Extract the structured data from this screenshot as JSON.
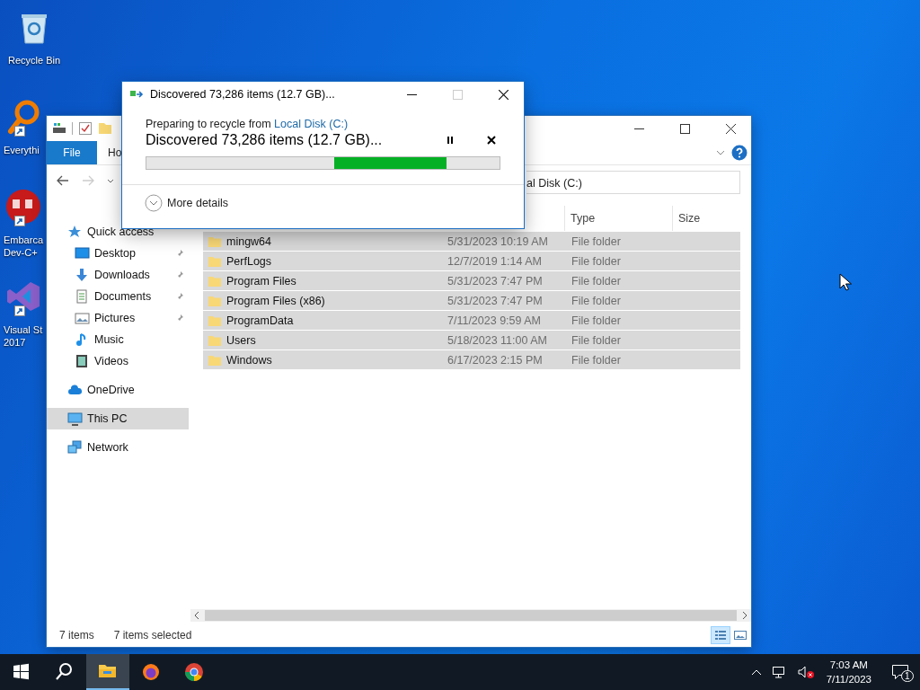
{
  "desktop": {
    "icons": [
      {
        "kind": "recycle",
        "lines": [
          "Recycle Bin"
        ],
        "shortcut": false
      },
      {
        "kind": "magnifier",
        "lines": [
          "Everythi"
        ],
        "shortcut": true
      },
      {
        "kind": "devcpp",
        "lines": [
          "Embarca",
          "Dev-C+"
        ],
        "shortcut": true
      },
      {
        "kind": "vstudio",
        "lines": [
          "Visual St",
          "2017"
        ],
        "shortcut": true
      }
    ]
  },
  "explorer": {
    "ribbon_tabs": [
      {
        "label": "File",
        "kind": "file_menu"
      },
      {
        "label": "Ho",
        "kind": "tab"
      }
    ],
    "address": "al Disk (C:)",
    "columns": [
      "Type",
      "Size"
    ],
    "nav": [
      {
        "label": "Quick access",
        "kind": "star",
        "pinned": false,
        "selected": false,
        "children": [
          {
            "label": "Desktop",
            "kind": "desktop",
            "pinned": true,
            "selected": false
          },
          {
            "label": "Downloads",
            "kind": "download",
            "pinned": true,
            "selected": false
          },
          {
            "label": "Documents",
            "kind": "document",
            "pinned": true,
            "selected": false
          },
          {
            "label": "Pictures",
            "kind": "pictures",
            "pinned": true,
            "selected": false
          },
          {
            "label": "Music",
            "kind": "music",
            "pinned": false,
            "selected": false
          },
          {
            "label": "Videos",
            "kind": "videos",
            "pinned": false,
            "selected": false
          }
        ]
      },
      {
        "label": "OneDrive",
        "kind": "cloud",
        "pinned": false,
        "selected": false
      },
      {
        "label": "This PC",
        "kind": "pc",
        "pinned": false,
        "selected": true
      },
      {
        "label": "Network",
        "kind": "network",
        "pinned": false,
        "selected": false
      }
    ],
    "rows": [
      {
        "name": "mingw64",
        "date": "5/31/2023 10:19 AM",
        "type": "File folder",
        "selected": true
      },
      {
        "name": "PerfLogs",
        "date": "12/7/2019 1:14 AM",
        "type": "File folder",
        "selected": true
      },
      {
        "name": "Program Files",
        "date": "5/31/2023 7:47 PM",
        "type": "File folder",
        "selected": true
      },
      {
        "name": "Program Files (x86)",
        "date": "5/31/2023 7:47 PM",
        "type": "File folder",
        "selected": true
      },
      {
        "name": "ProgramData",
        "date": "7/11/2023 9:59 AM",
        "type": "File folder",
        "selected": true
      },
      {
        "name": "Users",
        "date": "5/18/2023 11:00 AM",
        "type": "File folder",
        "selected": true
      },
      {
        "name": "Windows",
        "date": "6/17/2023 2:15 PM",
        "type": "File folder",
        "selected": true
      }
    ],
    "status": {
      "count": "7 items",
      "selection": "7 items selected"
    },
    "view": {
      "details_selected": true
    }
  },
  "dialog": {
    "title": "Discovered 73,286 items (12.7 GB)...",
    "maximize_disabled": true,
    "source_prefix": "Preparing to recycle from",
    "source_link": "Local Disk (C:)",
    "status": "Discovered 73,286 items (12.7 GB)...",
    "progress": {
      "level": 0.85
    },
    "more_details": "More details"
  },
  "taskbar": {
    "apps": [
      {
        "kind": "start",
        "active": false
      },
      {
        "kind": "search",
        "active": false
      },
      {
        "kind": "explorer",
        "active": true
      },
      {
        "kind": "firefox",
        "active": false
      },
      {
        "kind": "chrome",
        "active": false
      }
    ],
    "volume_muted": true,
    "time": "7:03 AM",
    "date": "7/11/2023",
    "notifications": "1"
  }
}
